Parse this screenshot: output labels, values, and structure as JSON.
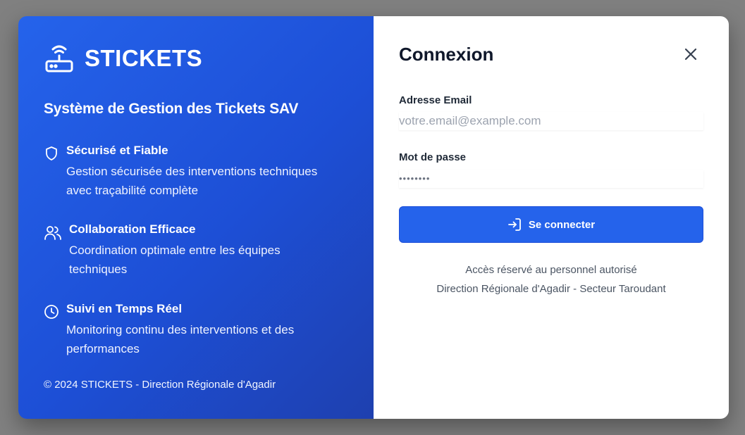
{
  "brand": {
    "name": "STICKETS",
    "icon": "router-icon",
    "tagline": "Système de Gestion des Tickets SAV"
  },
  "features": [
    {
      "icon": "shield-icon",
      "title": "Sécurisé et Fiable",
      "description": "Gestion sécurisée des interventions techniques avec traçabilité complète"
    },
    {
      "icon": "users-icon",
      "title": "Collaboration Efficace",
      "description": "Coordination optimale entre les équipes techniques"
    },
    {
      "icon": "clock-icon",
      "title": "Suivi en Temps Réel",
      "description": "Monitoring continu des interventions et des performances"
    }
  ],
  "footer": "© 2024 STICKETS - Direction Régionale d'Agadir",
  "login": {
    "title": "Connexion",
    "email_label": "Adresse Email",
    "email_placeholder": "votre.email@example.com",
    "password_label": "Mot de passe",
    "password_value": "••••••••",
    "submit_label": "Se connecter",
    "note_line1": "Accès réservé au personnel autorisé",
    "note_line2": "Direction Régionale d'Agadir - Secteur Taroudant"
  },
  "colors": {
    "primary": "#2563eb",
    "panel_gradient_end": "#1e40af",
    "text_dark": "#0f172a"
  }
}
